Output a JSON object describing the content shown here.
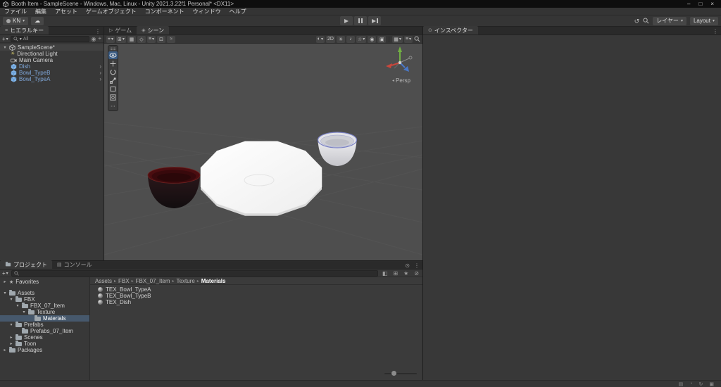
{
  "window": {
    "title": "Booth Item - SampleScene - Windows, Mac, Linux - Unity 2021.3.22f1 Personal* <DX11>",
    "minimize_label": "–",
    "maximize_label": "□",
    "close_label": "×"
  },
  "menu_bar": {
    "items": [
      "ファイル",
      "編集",
      "アセット",
      "ゲームオブジェクト",
      "コンポーネント",
      "ウィンドウ",
      "ヘルプ"
    ]
  },
  "toolbar": {
    "account_label": "KN",
    "layers_label": "レイヤー",
    "layout_label": "Layout"
  },
  "hierarchy": {
    "tab_label": "ヒエラルキー",
    "search_scope_label": "All",
    "scene_name": "SampleScene*",
    "items": [
      {
        "label": "Directional Light"
      },
      {
        "label": "Main Camera"
      },
      {
        "label": "Dish"
      },
      {
        "label": "Bowl_TypeB"
      },
      {
        "label": "Bowl_TypeA"
      }
    ]
  },
  "scene_view": {
    "game_tab_label": "ゲーム",
    "scene_tab_label": "シーン",
    "mode_2d_label": "2D",
    "persp_label": "Persp"
  },
  "inspector": {
    "tab_label": "インスペクター"
  },
  "project": {
    "tab_label": "プロジェクト",
    "console_tab_label": "コンソール",
    "favorites_label": "Favorites",
    "tree": [
      {
        "label": "Assets"
      },
      {
        "label": "FBX"
      },
      {
        "label": "FBX_07_Item"
      },
      {
        "label": "Texture"
      },
      {
        "label": "Materials"
      },
      {
        "label": "Prefabs"
      },
      {
        "label": "Prefabs_07_Item"
      },
      {
        "label": "Scenes"
      },
      {
        "label": "Toon"
      },
      {
        "label": "Packages"
      }
    ],
    "breadcrumb": [
      "Assets",
      "FBX",
      "FBX_07_Item",
      "Texture",
      "Materials"
    ],
    "files": [
      {
        "name": "TEX_Bowl_TypeA"
      },
      {
        "name": "TEX_Bowl_TypeB"
      },
      {
        "name": "TEX_Dish"
      }
    ]
  },
  "colors": {
    "prefab_text": "#7ea6d8",
    "selection_bg": "#46586c",
    "viewport_bg": "#4e4e4e",
    "axis_x_red": "#c8473c",
    "axis_y_green": "#72b043",
    "axis_z_blue": "#4a78c8",
    "bowl_dark_red": "#4b0d10",
    "plate_white": "#fbfbfb"
  },
  "icons": {
    "chevron_down": "▾",
    "chevron_right": "▸",
    "expand_right": "›",
    "menu": "≡",
    "ellipsis": "⋮",
    "dots": "⋯",
    "plus": "+",
    "star": "★",
    "sun": "☀",
    "cloud": "☁",
    "history": "↺",
    "grid": "▦",
    "half_sphere": "◐",
    "note": "♪",
    "sparkle": "☆",
    "eye": "◉",
    "camera_box": "▣",
    "target": "⌖",
    "square_plus": "⊞",
    "diamond": "◇",
    "boxed_dot": "⊡",
    "waves": "≈",
    "tag": "◧",
    "slash_circle": "⊘",
    "doc": "▤",
    "clock": "◔",
    "refresh": "↻",
    "triangle_left": "◂",
    "circle_dot": "⊙",
    "play_outline": "▷",
    "scene_diamond": "◈"
  }
}
